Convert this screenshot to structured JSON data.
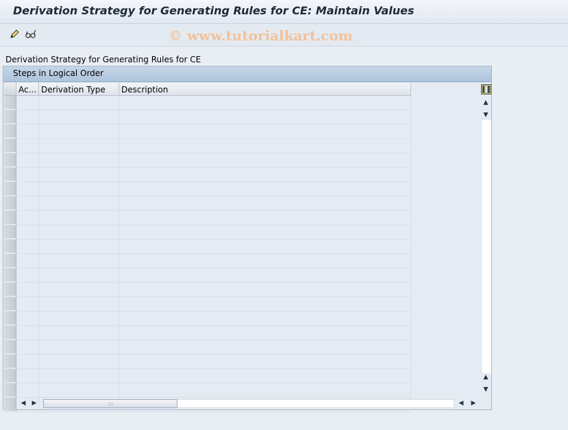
{
  "window": {
    "title": "Derivation Strategy for Generating Rules for CE: Maintain Values"
  },
  "toolbar": {
    "icons": [
      "pencil-edit-icon",
      "display-change-glasses-icon"
    ],
    "watermark": "© www.tutorialkart.com"
  },
  "main": {
    "section_label": "Derivation Strategy for Generating Rules for CE",
    "table": {
      "title": "Steps in Logical Order",
      "columns": [
        "Ac...",
        "Derivation Type",
        "Description"
      ],
      "rows": [
        [
          "",
          "",
          ""
        ],
        [
          "",
          "",
          ""
        ],
        [
          "",
          "",
          ""
        ],
        [
          "",
          "",
          ""
        ],
        [
          "",
          "",
          ""
        ],
        [
          "",
          "",
          ""
        ],
        [
          "",
          "",
          ""
        ],
        [
          "",
          "",
          ""
        ],
        [
          "",
          "",
          ""
        ],
        [
          "",
          "",
          ""
        ],
        [
          "",
          "",
          ""
        ],
        [
          "",
          "",
          ""
        ],
        [
          "",
          "",
          ""
        ],
        [
          "",
          "",
          ""
        ],
        [
          "",
          "",
          ""
        ],
        [
          "",
          "",
          ""
        ],
        [
          "",
          "",
          ""
        ],
        [
          "",
          "",
          ""
        ],
        [
          "",
          "",
          ""
        ],
        [
          "",
          "",
          ""
        ],
        [
          "",
          "",
          ""
        ],
        [
          "",
          "",
          ""
        ]
      ],
      "hscroll_grip": ":::"
    }
  },
  "colors": {
    "background": "#e9eef5",
    "title_text": "#1e2a3a",
    "watermark": "#f2c29a",
    "panel_header": "#aec5dd"
  }
}
